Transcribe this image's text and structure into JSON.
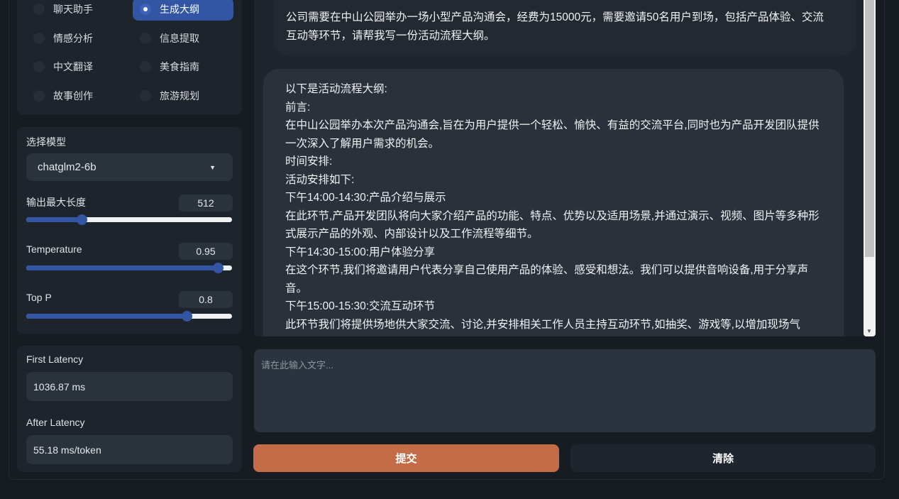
{
  "tasks": {
    "options": [
      "聊天助手",
      "生成大纲",
      "情感分析",
      "信息提取",
      "中文翻译",
      "美食指南",
      "故事创作",
      "旅游规划"
    ],
    "selected": "生成大纲"
  },
  "model": {
    "label": "选择模型",
    "value": "chatglm2-6b"
  },
  "sliders": [
    {
      "label": "输出最大长度",
      "value": "512",
      "fraction": 0.27
    },
    {
      "label": "Temperature",
      "value": "0.95",
      "fraction": 0.93
    },
    {
      "label": "Top P",
      "value": "0.8",
      "fraction": 0.78
    }
  ],
  "latency": {
    "first_label": "First Latency",
    "first_value": "1036.87 ms",
    "after_label": "After Latency",
    "after_value": "55.18 ms/token"
  },
  "chat": {
    "user": [
      "公司需要在中山公园举办一场小型产品沟通会，经费为15000元，需要邀请50名用户到场，包括产品体验、交流",
      "互动等环节，请帮我写一份活动流程大纲。"
    ],
    "bot": [
      "以下是活动流程大纲:",
      "前言:",
      "在中山公园举办本次产品沟通会,旨在为用户提供一个轻松、愉快、有益的交流平台,同时也为产品开发团队提供",
      "一次深入了解用户需求的机会。",
      "时间安排:",
      "活动安排如下:",
      "下午14:00-14:30:产品介绍与展示",
      "在此环节,产品开发团队将向大家介绍产品的功能、特点、优势以及适用场景,并通过演示、视频、图片等多种形",
      "式展示产品的外观、内部设计以及工作流程等细节。",
      "下午14:30-15:00:用户体验分享",
      "在这个环节,我们将邀请用户代表分享自己使用产品的体验、感受和想法。我们可以提供音响设备,用于分享声",
      "音。",
      "下午15:00-15:30:交流互动环节",
      "此环节我们将提供场地供大家交流、讨论,并安排相关工作人员主持互动环节,如抽奖、游戏等,以增加现场气"
    ]
  },
  "input": {
    "placeholder": "请在此输入文字..."
  },
  "buttons": {
    "submit": "提交",
    "clear": "清除"
  },
  "colors": {
    "accent": "#3255a4",
    "submit": "#c46c47"
  }
}
